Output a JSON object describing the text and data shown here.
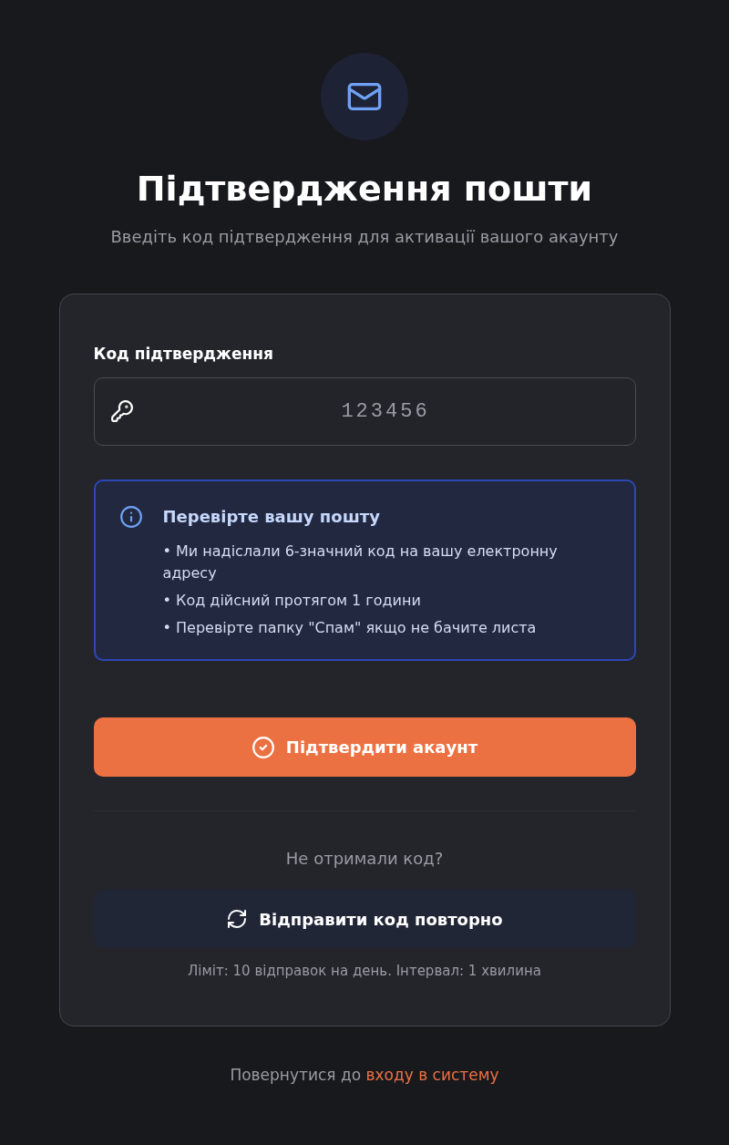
{
  "header": {
    "title": "Підтвердження пошти",
    "subtitle": "Введіть код підтвердження для активації вашого акаунту"
  },
  "form": {
    "code_field": {
      "label": "Код підтвердження",
      "placeholder": "123456"
    },
    "info": {
      "title": "Перевірте вашу пошту",
      "items": [
        "• Ми надіслали 6-значний код на вашу електронну адресу",
        "• Код дійсний протягом 1 години",
        "• Перевірте папку \"Спам\" якщо не бачите листа"
      ]
    },
    "submit_button": "Підтвердити акаунт",
    "resend": {
      "prompt": "Не отримали код?",
      "button": "Відправити код повторно",
      "limit_note": "Ліміт: 10 відправок на день. Інтервал: 1 хвилина"
    }
  },
  "footer": {
    "text": "Повернутися до",
    "link": "входу в систему"
  }
}
